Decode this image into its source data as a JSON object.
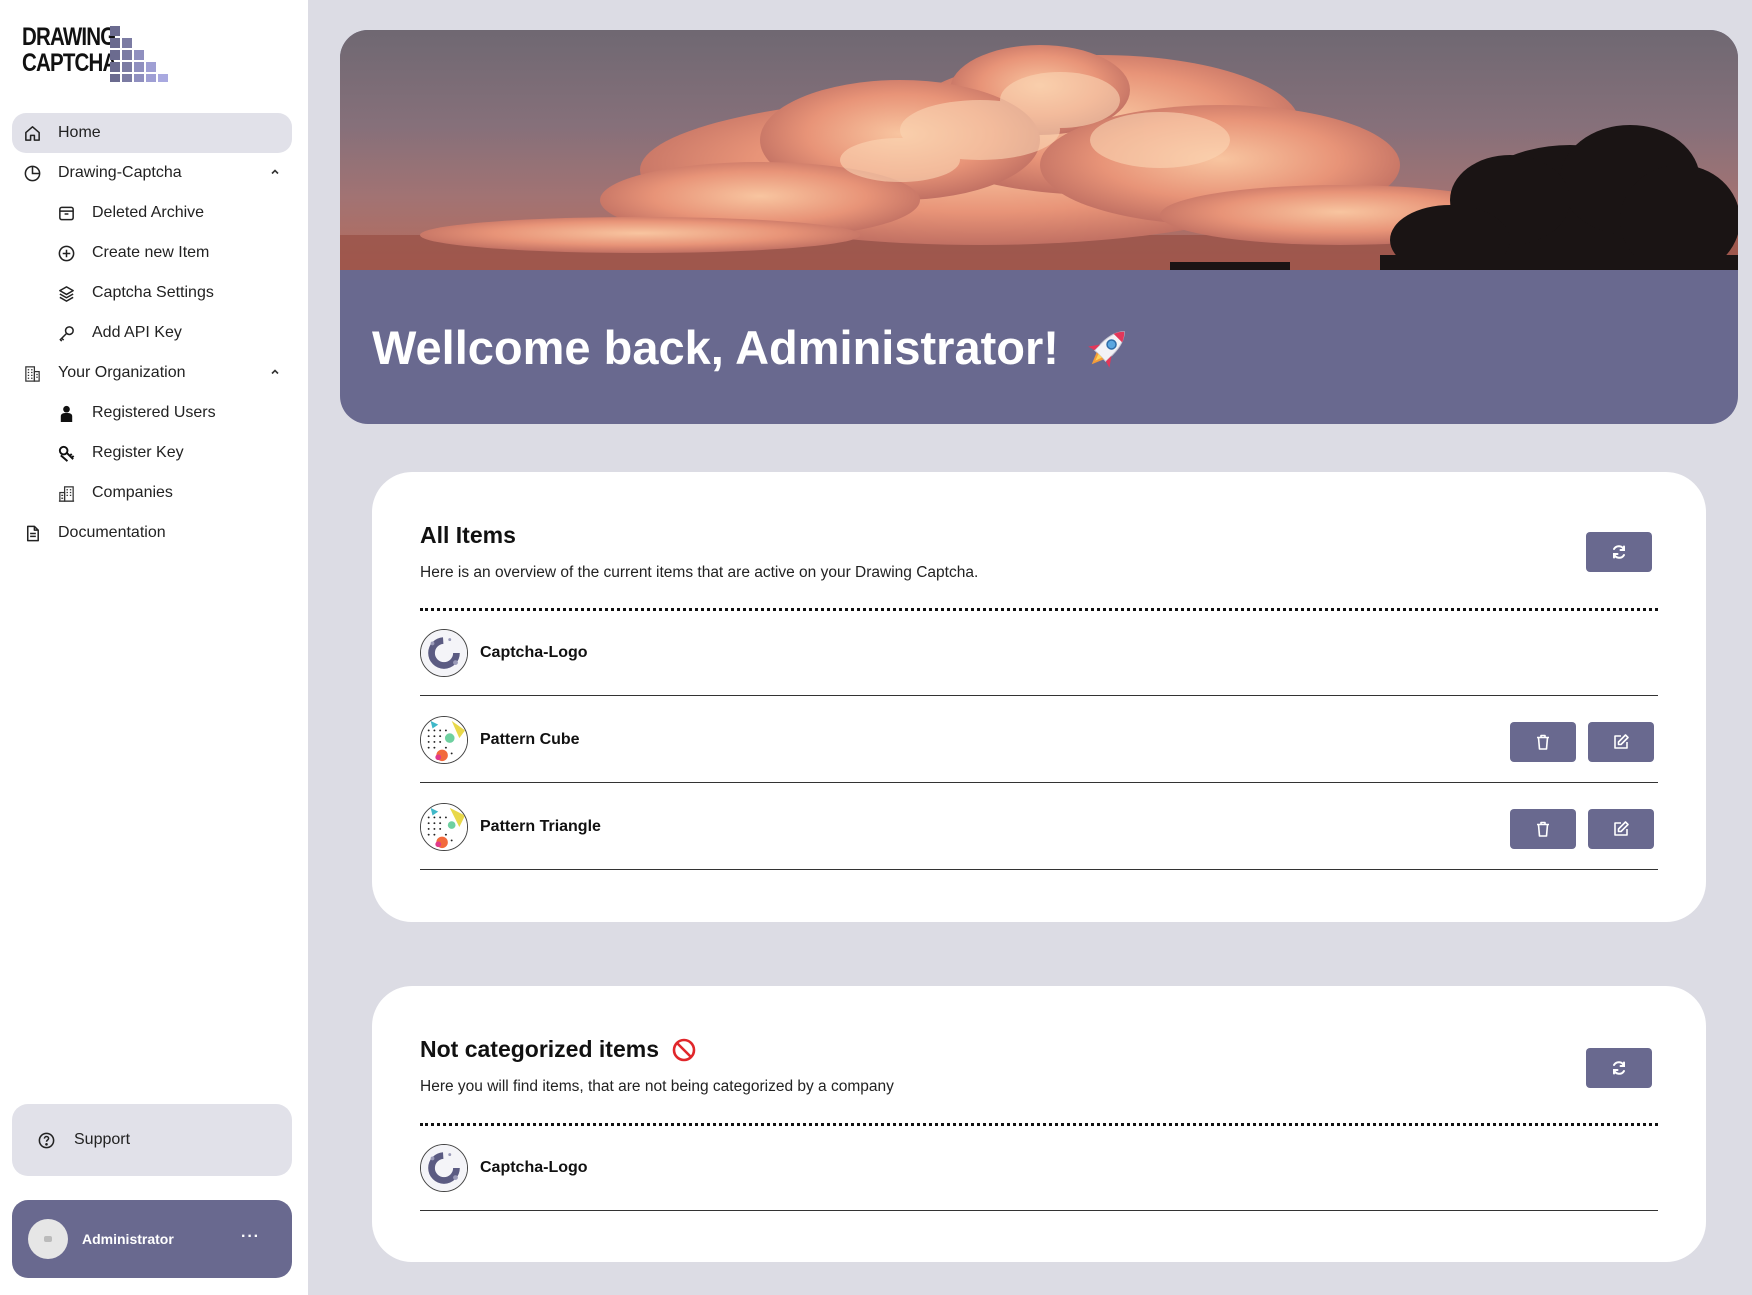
{
  "app": {
    "logo_line1": "DRAWING",
    "logo_line2": "CAPTCHA"
  },
  "sidebar": {
    "items": [
      {
        "label": "Home",
        "icon": "home-icon",
        "active": true
      },
      {
        "label": "Drawing-Captcha",
        "icon": "pie-chart-icon",
        "expanded": true
      },
      {
        "label": "Deleted Archive",
        "icon": "archive-icon"
      },
      {
        "label": "Create new Item",
        "icon": "plus-circle-icon"
      },
      {
        "label": "Captcha Settings",
        "icon": "layers-icon"
      },
      {
        "label": "Add API Key",
        "icon": "key-icon"
      },
      {
        "label": "Your Organization",
        "icon": "building-icon",
        "expanded": true
      },
      {
        "label": "Registered Users",
        "icon": "user-icon"
      },
      {
        "label": "Register Key",
        "icon": "register-key-icon"
      },
      {
        "label": "Companies",
        "icon": "companies-icon"
      },
      {
        "label": "Documentation",
        "icon": "document-icon"
      }
    ],
    "support_label": "Support",
    "user_name": "Administrator",
    "user_more": "···"
  },
  "hero": {
    "title": "Wellcome back, Administrator!",
    "emoji": "rocket-icon"
  },
  "all_items": {
    "title": "All Items",
    "description": "Here is an overview of the current items that are active on your Drawing Captcha.",
    "rows": [
      {
        "name": "Captcha-Logo",
        "thumb": "captcha-logo",
        "actions": false
      },
      {
        "name": "Pattern Cube",
        "thumb": "pattern",
        "actions": true
      },
      {
        "name": "Pattern Triangle",
        "thumb": "pattern",
        "actions": true
      }
    ]
  },
  "uncategorized": {
    "title": "Not categorized items",
    "emoji": "no-entry-icon",
    "description": "Here you will find items, that are not being categorized by a company",
    "rows": [
      {
        "name": "Captcha-Logo",
        "thumb": "captcha-logo",
        "actions": false
      }
    ]
  },
  "colors": {
    "accent": "#69698f",
    "background": "#dcdce4",
    "active_nav": "#e1e1e9"
  }
}
